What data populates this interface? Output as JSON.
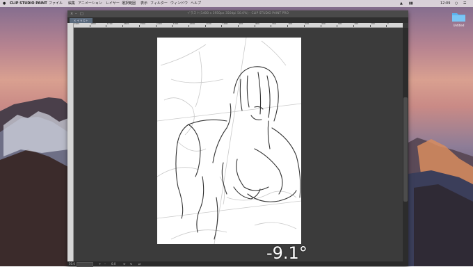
{
  "menubar": {
    "app_name": "CLIP STUDIO PAINT",
    "items": [
      "ファイル",
      "編集",
      "アニメーション",
      "レイヤー",
      "選択範囲",
      "表示",
      "フィルター",
      "ウィンドウ",
      "ヘルプ"
    ],
    "clock": "12:09"
  },
  "desktop": {
    "folder_label": "Untitled"
  },
  "window": {
    "title": "イラスト(1400 x 1950px 350dpi 50.0%) - CLIP STUDIO PAINT PRO",
    "doc_tab": "イラスト",
    "ruler_labels": [
      "1900",
      "1800",
      "1700",
      "1600",
      "1500",
      "1400",
      "1300",
      "1200",
      "1100",
      "1000",
      "900",
      "800",
      "700",
      "600",
      "500",
      "400",
      "300",
      "200",
      "100",
      "0"
    ],
    "status": {
      "zoom": "50.0",
      "extra": "0.0"
    }
  },
  "overlay": {
    "rotation": "-9.1°"
  },
  "colors": {
    "app_bg": "#3a3a3a",
    "canvas_bg": "#3b3b3b",
    "paper": "#ffffff",
    "tab_accent": "#5a6a7c"
  }
}
